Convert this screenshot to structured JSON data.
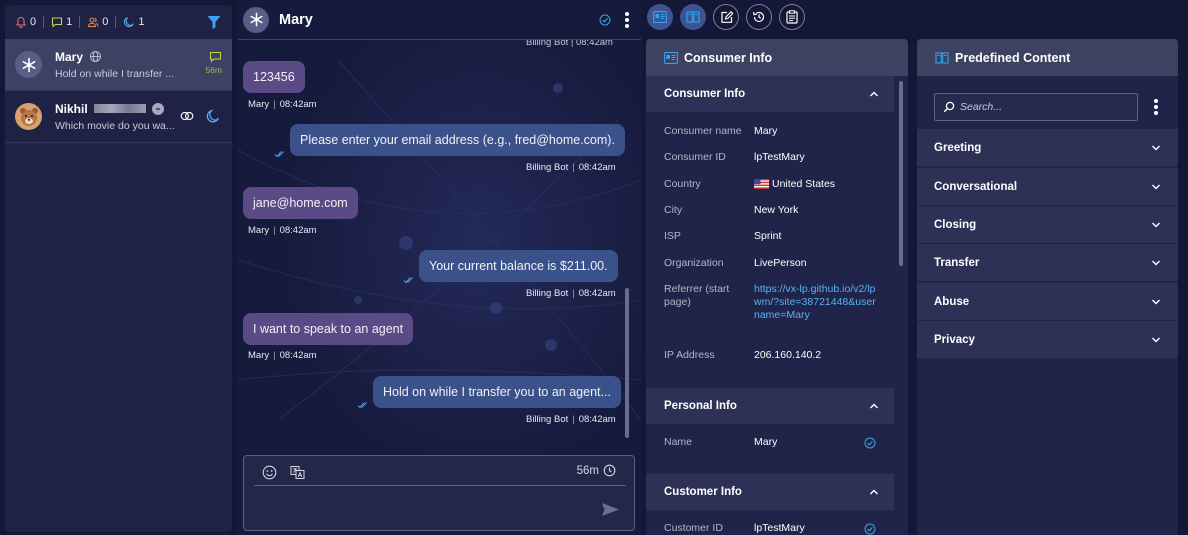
{
  "left_panel": {
    "counters": [
      {
        "icon": "bell-icon",
        "value": "0",
        "color": "#e86a6a"
      },
      {
        "icon": "chat-icon",
        "value": "1",
        "color": "#c6d34a"
      },
      {
        "icon": "users-icon",
        "value": "0",
        "color": "#e88a3c"
      },
      {
        "icon": "moon-icon",
        "value": "1",
        "color": "#5ba9ef"
      }
    ],
    "filter_icon": "filter-icon",
    "conversations": [
      {
        "name": "Mary",
        "preview": "Hold on while I transfer ...",
        "time": "56m",
        "active": true
      },
      {
        "name": "Nikhil",
        "preview": "Which movie do you wa...",
        "active": false
      }
    ]
  },
  "chat": {
    "title": "Mary",
    "top_partial_meta": "Billing Bot | 08:42am",
    "messages": [
      {
        "direction": "in",
        "text": "123456",
        "sender": "Mary",
        "time": "08:42am"
      },
      {
        "direction": "out",
        "text": "Please enter your email address (e.g., fred@home.com).",
        "sender": "Billing Bot",
        "time": "08:42am"
      },
      {
        "direction": "in",
        "text": "jane@home.com",
        "sender": "Mary",
        "time": "08:42am"
      },
      {
        "direction": "out",
        "text": "Your current balance is $211.00.",
        "sender": "Billing Bot",
        "time": "08:42am"
      },
      {
        "direction": "in",
        "text": "I want to speak to an agent",
        "sender": "Mary",
        "time": "08:42am"
      },
      {
        "direction": "out",
        "text": "Hold on while I transfer you to an agent...",
        "sender": "Billing Bot",
        "time": "08:42am"
      }
    ],
    "composer": {
      "timer": "56m"
    }
  },
  "toolbar": {
    "buttons": [
      "consumer-info-icon",
      "predefined-content-icon",
      "notes-icon",
      "history-icon",
      "clipboard-icon"
    ]
  },
  "consumer_info": {
    "title": "Consumer Info",
    "sections": {
      "consumer": {
        "title": "Consumer Info",
        "rows": [
          {
            "label": "Consumer name",
            "value": "Mary"
          },
          {
            "label": "Consumer ID",
            "value": "lpTestMary"
          },
          {
            "label": "Country",
            "value": "United States"
          },
          {
            "label": "City",
            "value": "New York"
          },
          {
            "label": "ISP",
            "value": "Sprint"
          },
          {
            "label": "Organization",
            "value": "LivePerson"
          },
          {
            "label": "Referrer (start page)",
            "value": "https://vx-lp.github.io/v2/lpwm/?site=38721448&username=Mary"
          },
          {
            "label": "IP Address",
            "value": "206.160.140.2"
          }
        ]
      },
      "personal": {
        "title": "Personal Info",
        "rows": [
          {
            "label": "Name",
            "value": "Mary"
          }
        ]
      },
      "customer": {
        "title": "Customer Info",
        "rows": [
          {
            "label": "Customer ID",
            "value": "lpTestMary"
          }
        ]
      }
    }
  },
  "predefined": {
    "title": "Predefined Content",
    "search_placeholder": "Search...",
    "categories": [
      "Greeting",
      "Conversational",
      "Closing",
      "Transfer",
      "Abuse",
      "Privacy"
    ]
  }
}
